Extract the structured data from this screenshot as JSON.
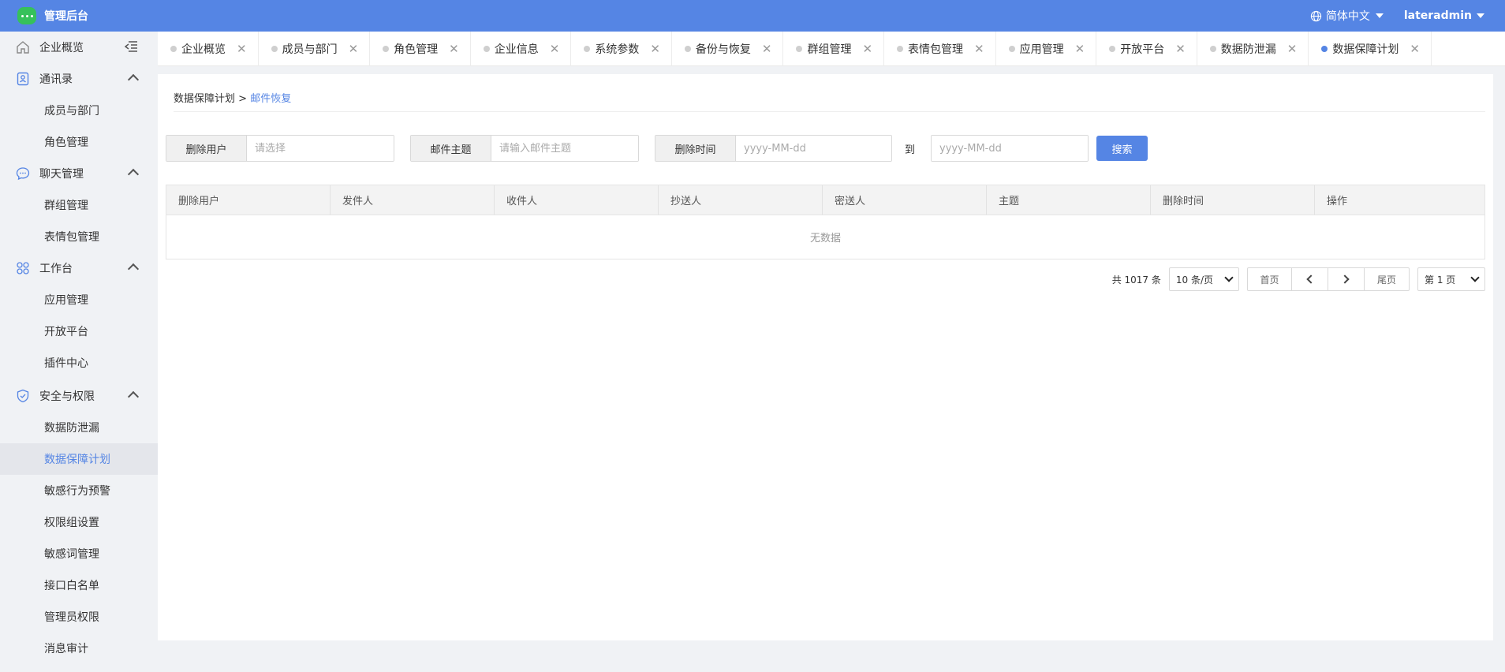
{
  "header": {
    "app_title": "管理后台",
    "language": "简体中文",
    "username": "lateradmin"
  },
  "sidebar": {
    "overview": "企业概览",
    "groups": [
      {
        "label": "通讯录",
        "icon": "contacts-icon",
        "items": [
          "成员与部门",
          "角色管理"
        ]
      },
      {
        "label": "聊天管理",
        "icon": "chat-icon",
        "items": [
          "群组管理",
          "表情包管理"
        ]
      },
      {
        "label": "工作台",
        "icon": "workbench-icon",
        "items": [
          "应用管理",
          "开放平台",
          "插件中心"
        ]
      },
      {
        "label": "安全与权限",
        "icon": "shield-icon",
        "items": [
          "数据防泄漏",
          "数据保障计划",
          "敏感行为预警",
          "权限组设置",
          "敏感词管理",
          "接口白名单",
          "管理员权限",
          "消息审计"
        ]
      }
    ],
    "active_item": "数据保障计划"
  },
  "tabs": [
    "企业概览",
    "成员与部门",
    "角色管理",
    "企业信息",
    "系统参数",
    "备份与恢复",
    "群组管理",
    "表情包管理",
    "应用管理",
    "开放平台",
    "数据防泄漏",
    "数据保障计划"
  ],
  "active_tab": "数据保障计划",
  "breadcrumb": {
    "parent": "数据保障计划",
    "separator": ">",
    "current": "邮件恢复"
  },
  "filters": {
    "deleted_user_label": "删除用户",
    "deleted_user_placeholder": "请选择",
    "subject_label": "邮件主题",
    "subject_placeholder": "请输入邮件主题",
    "delete_time_label": "删除时间",
    "date_placeholder": "yyyy-MM-dd",
    "to_label": "到",
    "search_button": "搜索"
  },
  "table": {
    "columns": [
      "删除用户",
      "发件人",
      "收件人",
      "抄送人",
      "密送人",
      "主题",
      "删除时间",
      "操作"
    ],
    "empty_text": "无数据"
  },
  "pagination": {
    "total": "共 1017 条",
    "page_size": "10 条/页",
    "first": "首页",
    "last": "尾页",
    "current_page": "第 1 页"
  },
  "colors": {
    "primary": "#5585e4",
    "logo": "#36c15b"
  }
}
